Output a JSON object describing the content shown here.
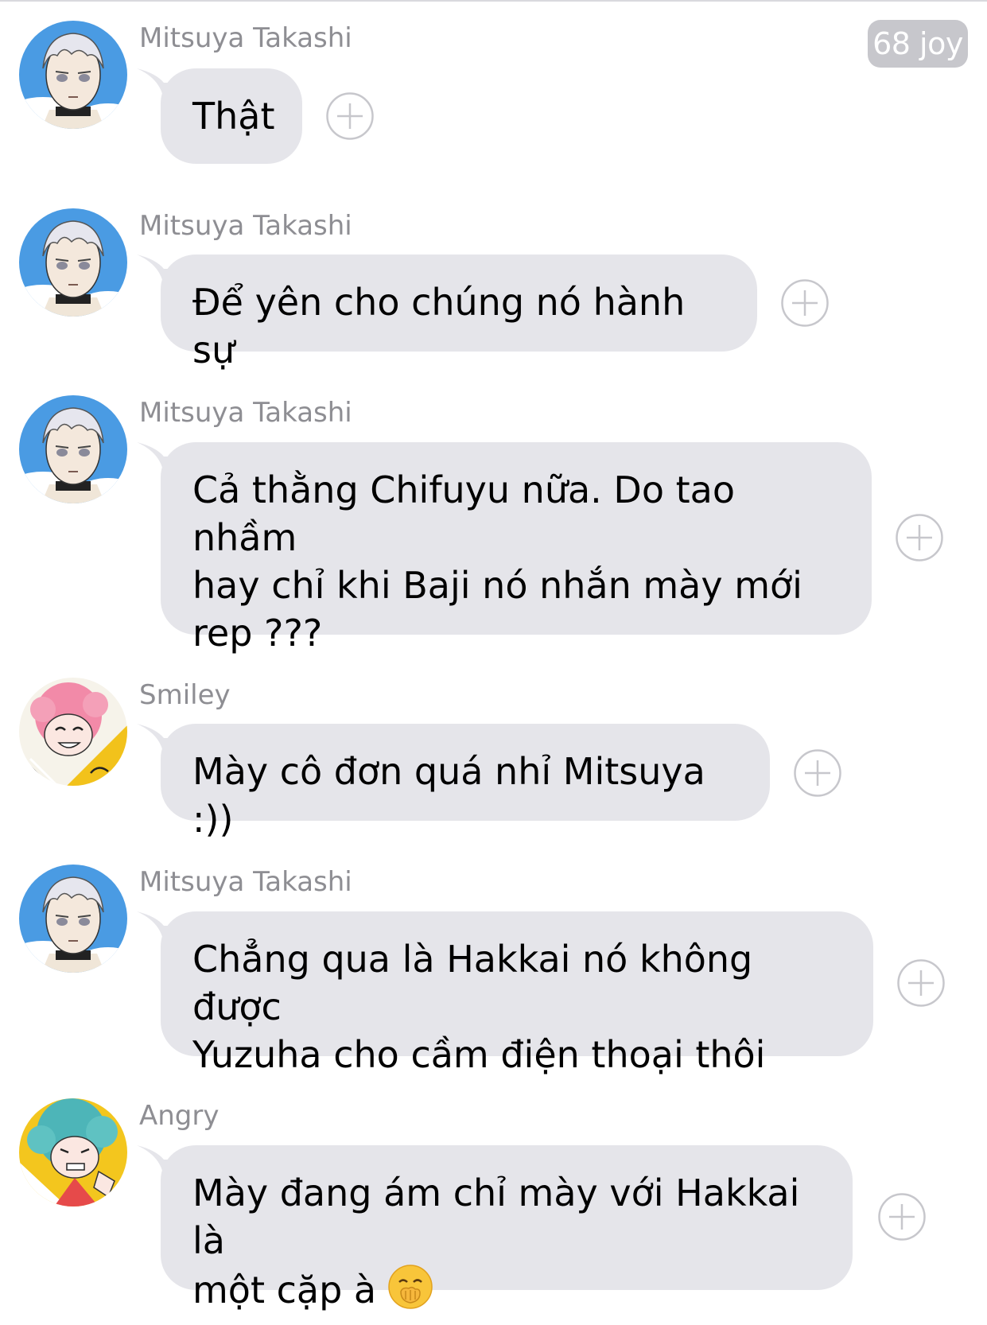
{
  "header": {
    "badge": "68 joy"
  },
  "messages": [
    {
      "sender": "Mitsuya Takashi",
      "avatar": "mitsuya-avatar",
      "text": "Thật",
      "action": "add-reaction"
    },
    {
      "sender": "Mitsuya Takashi",
      "avatar": "mitsuya-avatar",
      "text": "Để yên cho chúng nó hành sự",
      "action": "add-reaction"
    },
    {
      "sender": "Mitsuya Takashi",
      "avatar": "mitsuya-avatar",
      "text": "Cả thằng Chifuyu nữa. Do tao nhầm\nhay chỉ khi Baji nó nhắn mày mới\nrep ???",
      "action": "add-reaction"
    },
    {
      "sender": "Smiley",
      "avatar": "smiley-avatar",
      "text": "Mày cô đơn quá nhỉ Mitsuya :))",
      "action": "add-reaction"
    },
    {
      "sender": "Mitsuya Takashi",
      "avatar": "mitsuya-avatar",
      "text": "Chẳng qua là Hakkai nó không được\nYuzuha cho cầm điện thoại thôi",
      "action": "add-reaction"
    },
    {
      "sender": "Angry",
      "avatar": "angry-avatar",
      "text": "Mày đang ám chỉ mày với Hakkai là\nmột cặp à",
      "emoji": "hand-over-mouth-emoji",
      "action": "add-reaction"
    }
  ],
  "colors": {
    "bubble": "#e5e5ea",
    "sender_name": "#8e8e93",
    "badge_bg": "#c7c7cc",
    "plus_icon": "#c7c7cc"
  }
}
